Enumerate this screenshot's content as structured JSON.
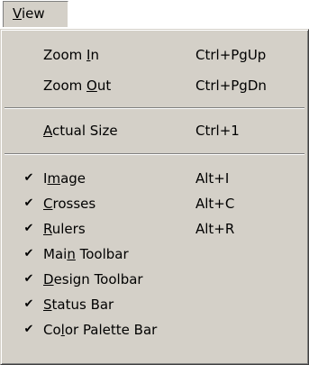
{
  "menubar": {
    "title_accel": "V",
    "title_rest": "iew"
  },
  "menu": {
    "items": [
      {
        "pre": "Zoom ",
        "accel": "I",
        "post": "n",
        "shortcut": "Ctrl+PgUp",
        "checked": false
      },
      {
        "pre": "Zoom ",
        "accel": "O",
        "post": "ut",
        "shortcut": "Ctrl+PgDn",
        "checked": false
      },
      {
        "pre": "",
        "accel": "A",
        "post": "ctual Size",
        "shortcut": "Ctrl+1",
        "checked": false
      },
      {
        "pre": "I",
        "accel": "m",
        "post": "age",
        "shortcut": "Alt+I",
        "checked": true
      },
      {
        "pre": "",
        "accel": "C",
        "post": "rosses",
        "shortcut": "Alt+C",
        "checked": true
      },
      {
        "pre": "",
        "accel": "R",
        "post": "ulers",
        "shortcut": "Alt+R",
        "checked": true
      },
      {
        "pre": "Mai",
        "accel": "n",
        "post": " Toolbar",
        "shortcut": "",
        "checked": true
      },
      {
        "pre": "",
        "accel": "D",
        "post": "esign Toolbar",
        "shortcut": "",
        "checked": true
      },
      {
        "pre": "",
        "accel": "S",
        "post": "tatus Bar",
        "shortcut": "",
        "checked": true
      },
      {
        "pre": "Co",
        "accel": "l",
        "post": "or Palette Bar",
        "shortcut": "",
        "checked": true
      }
    ],
    "check_glyph": "✔"
  }
}
